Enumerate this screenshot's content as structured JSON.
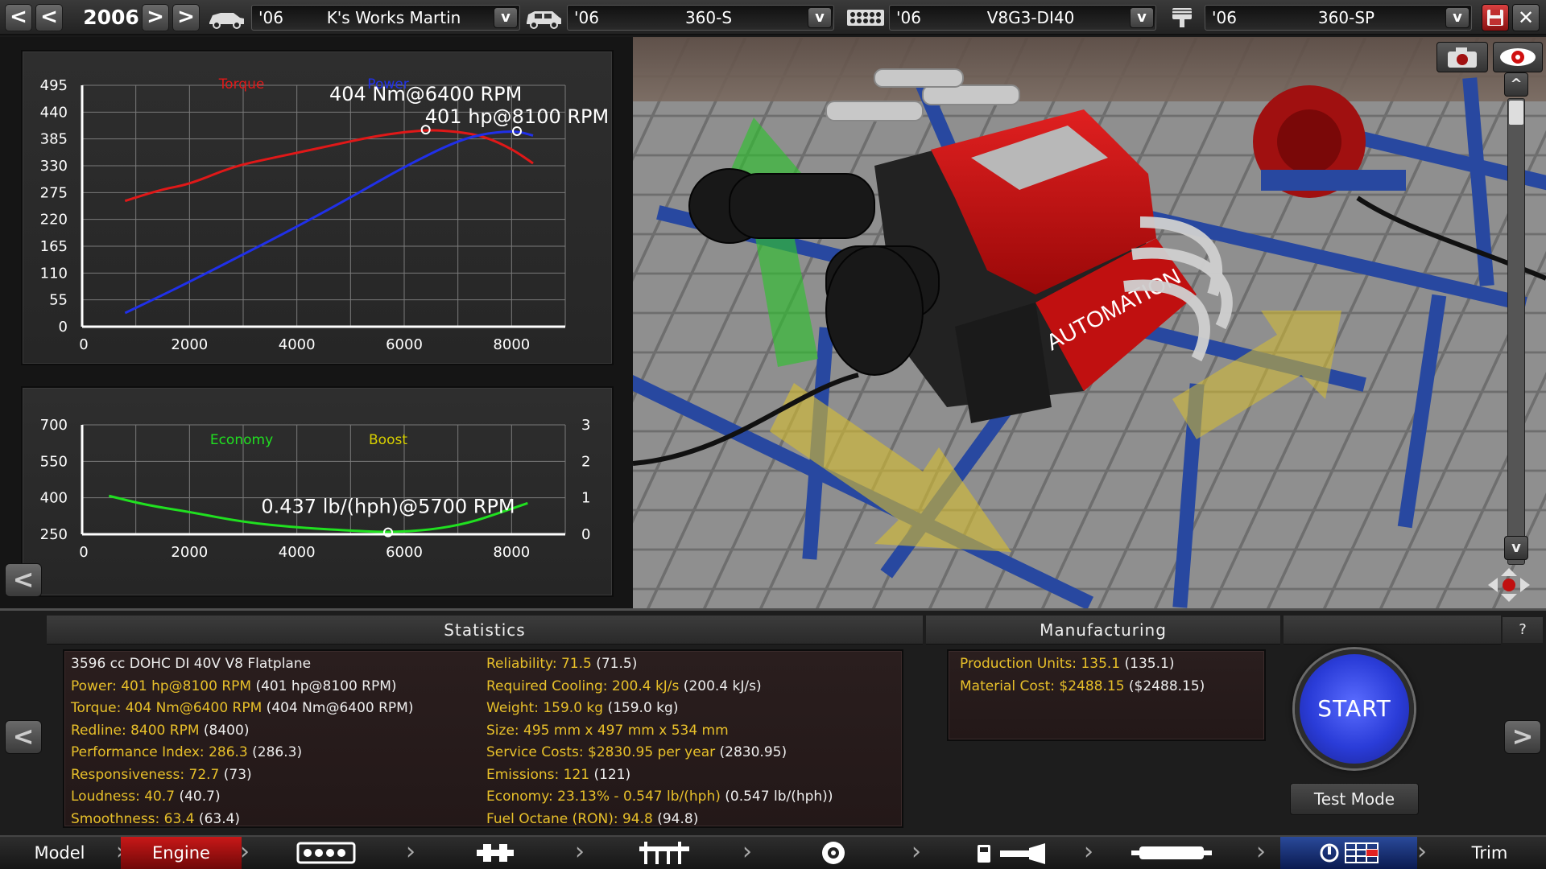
{
  "topbar": {
    "prev_fast": "<",
    "prev": "<",
    "year": "2006",
    "next": ">",
    "next_fast": ">",
    "model": {
      "year": "'06",
      "name": "K's Works Martin",
      "dd": "v"
    },
    "trim": {
      "year": "'06",
      "name": "360-S",
      "dd": "v"
    },
    "engine": {
      "year": "'06",
      "name": "V8G3-DI40",
      "dd": "v"
    },
    "variant": {
      "year": "'06",
      "name": "360-SP",
      "dd": "v"
    },
    "close": "✕"
  },
  "chart_data": [
    {
      "type": "line",
      "title": "",
      "xlabel": "",
      "ylabel": "",
      "x_ticks": [
        "0",
        "2000",
        "4000",
        "6000",
        "8000"
      ],
      "y_ticks": [
        "495",
        "440",
        "385",
        "330",
        "275",
        "220",
        "165",
        "110",
        "55",
        "0"
      ],
      "xlim": [
        0,
        9000
      ],
      "ylim": [
        0,
        495
      ],
      "grid": true,
      "legend": [
        {
          "name": "Torque",
          "color": "#e01818"
        },
        {
          "name": "Power",
          "color": "#2030e8"
        }
      ],
      "series": [
        {
          "name": "Torque",
          "color": "#e01818",
          "x": [
            800,
            1500,
            2000,
            2800,
            3500,
            4500,
            5500,
            6400,
            7000,
            7500,
            8000,
            8400
          ],
          "y": [
            258,
            282,
            292,
            328,
            345,
            368,
            392,
            404,
            400,
            390,
            365,
            335
          ]
        },
        {
          "name": "Power",
          "color": "#2030e8",
          "x": [
            800,
            1500,
            2000,
            3000,
            4000,
            5000,
            6000,
            7000,
            7600,
            8100,
            8400
          ],
          "y": [
            28,
            65,
            92,
            148,
            205,
            265,
            328,
            382,
            398,
            401,
            392
          ]
        }
      ],
      "annotations": [
        {
          "text": "404 Nm@6400 RPM",
          "x": 6400,
          "y": 404
        },
        {
          "text": "401 hp@8100 RPM",
          "x": 8100,
          "y": 401
        }
      ]
    },
    {
      "type": "line",
      "title": "",
      "x_ticks": [
        "0",
        "2000",
        "4000",
        "6000",
        "8000"
      ],
      "y_ticks": [
        "700",
        "550",
        "400",
        "250"
      ],
      "y2_ticks": [
        "3",
        "2",
        "1",
        "0"
      ],
      "xlim": [
        0,
        9000
      ],
      "ylim": [
        250,
        700
      ],
      "y2lim": [
        0,
        3
      ],
      "grid": true,
      "legend": [
        {
          "name": "Economy",
          "color": "#20e020"
        },
        {
          "name": "Boost",
          "color": "#d8d000"
        }
      ],
      "series": [
        {
          "name": "Economy",
          "color": "#20e020",
          "x": [
            500,
            1200,
            2000,
            3000,
            4000,
            5000,
            5700,
            6500,
            7200,
            7800,
            8300
          ],
          "y": [
            408,
            370,
            342,
            300,
            278,
            265,
            258,
            268,
            296,
            340,
            378
          ]
        }
      ],
      "annotations": [
        {
          "text": "0.437 lb/(hph)@5700 RPM",
          "x": 5700,
          "y": 258
        }
      ]
    }
  ],
  "left": {
    "back": "<"
  },
  "view": {
    "up": "^",
    "down": "v"
  },
  "statistics": {
    "header": "Statistics",
    "col1": [
      {
        "label": "3596 cc DOHC DI 40V V8 Flatplane",
        "paren": ""
      },
      {
        "label": "Power: 401 hp@8100 RPM",
        "paren": "(401 hp@8100 RPM)"
      },
      {
        "label": "Torque: 404 Nm@6400 RPM",
        "paren": "(404 Nm@6400 RPM)"
      },
      {
        "label": "Redline: 8400 RPM",
        "paren": "(8400)"
      },
      {
        "label": "Performance Index: 286.3",
        "paren": "(286.3)"
      },
      {
        "label": "Responsiveness: 72.7",
        "paren": "(73)"
      },
      {
        "label": "Loudness: 40.7",
        "paren": "(40.7)"
      },
      {
        "label": "Smoothness: 63.4",
        "paren": "(63.4)"
      }
    ],
    "col2": [
      {
        "label": "Reliability: 71.5",
        "paren": "(71.5)"
      },
      {
        "label": "Required Cooling: 200.4 kJ/s",
        "paren": "(200.4 kJ/s)"
      },
      {
        "label": "Weight: 159.0 kg",
        "paren": "(159.0 kg)"
      },
      {
        "label": "Size: 495 mm x 497 mm x 534 mm",
        "paren": ""
      },
      {
        "label": "Service Costs: $2830.95 per year",
        "paren": "(2830.95)"
      },
      {
        "label": "Emissions: 121",
        "paren": "(121)"
      },
      {
        "label": "Economy: 23.13% - 0.547 lb/(hph)",
        "paren": "(0.547 lb/(hph))"
      },
      {
        "label": "Fuel Octane (RON): 94.8",
        "paren": "(94.8)"
      }
    ]
  },
  "manufacturing": {
    "header": "Manufacturing",
    "items": [
      {
        "label": "Production Units: 135.1",
        "paren": "(135.1)"
      },
      {
        "label": "Material Cost: $2488.15",
        "paren": "($2488.15)"
      }
    ]
  },
  "actions": {
    "start": "START",
    "test": "Test Mode",
    "help": "?",
    "prev": "<",
    "next": ">"
  },
  "nav": {
    "model": "Model",
    "engine": "Engine",
    "trim": "Trim",
    "icons": [
      "engine-block-icon",
      "crankshaft-icon",
      "cylinder-head-icon",
      "turbo-icon",
      "fuel-system-icon",
      "exhaust-icon",
      "tuning-icon"
    ]
  }
}
